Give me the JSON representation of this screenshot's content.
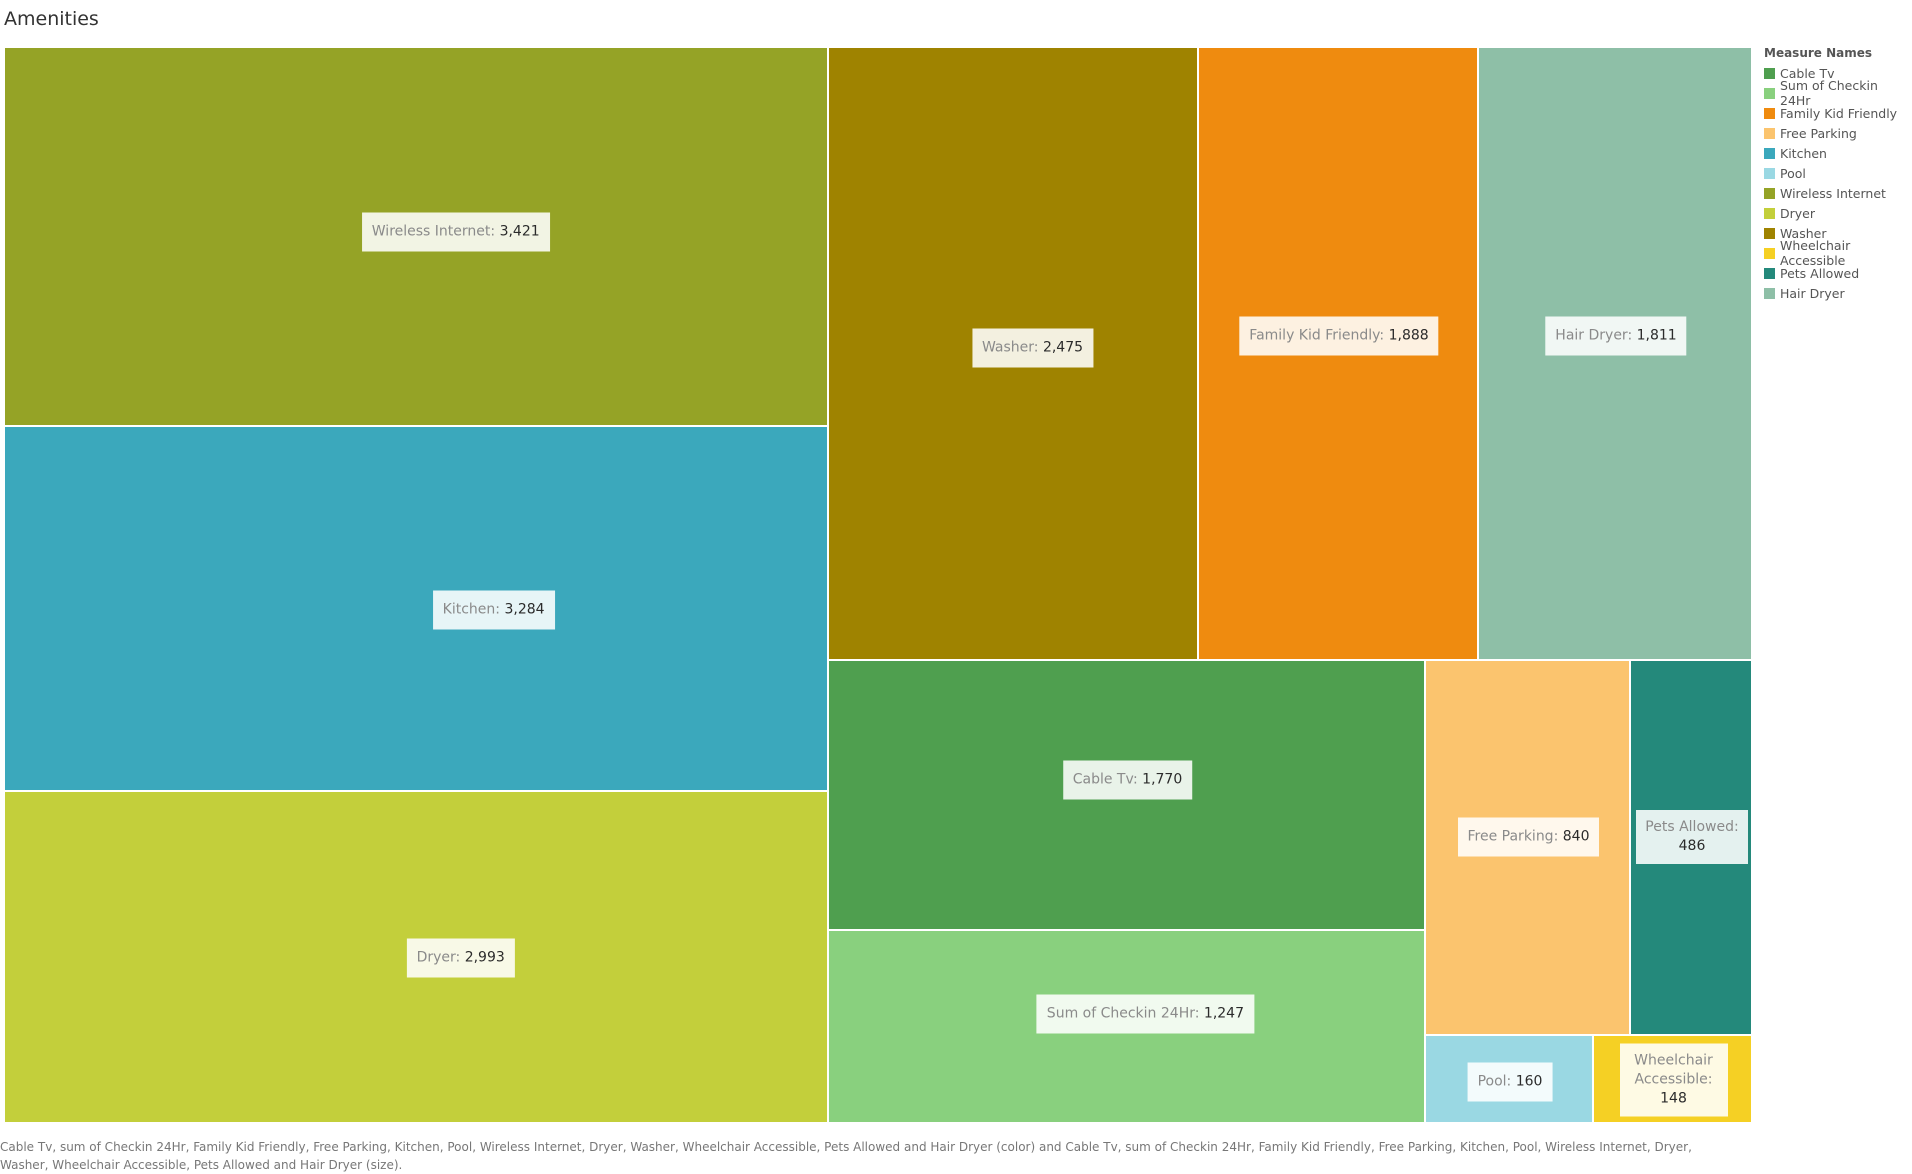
{
  "title": "Amenities",
  "caption": "Cable Tv, sum of Checkin 24Hr, Family Kid Friendly, Free Parking, Kitchen, Pool, Wireless Internet, Dryer, Washer, Wheelchair Accessible, Pets Allowed and Hair Dryer (color) and Cable Tv, sum of Checkin 24Hr, Family Kid Friendly, Free Parking, Kitchen, Pool, Wireless Internet, Dryer, Washer, Wheelchair Accessible, Pets Allowed and Hair Dryer (size).",
  "legend": {
    "title": "Measure Names",
    "items": [
      {
        "label": "Cable Tv",
        "color": "#4f9f4f"
      },
      {
        "label": "Sum of Checkin 24Hr",
        "color": "#89d07e"
      },
      {
        "label": "Family Kid Friendly",
        "color": "#ef8b0f"
      },
      {
        "label": "Free Parking",
        "color": "#fbc46e"
      },
      {
        "label": "Kitchen",
        "color": "#3ba8bc"
      },
      {
        "label": "Pool",
        "color": "#9ad8e3"
      },
      {
        "label": "Wireless Internet",
        "color": "#95a326"
      },
      {
        "label": "Dryer",
        "color": "#c3cf3b"
      },
      {
        "label": "Washer",
        "color": "#9f8300"
      },
      {
        "label": "Wheelchair Accessible",
        "color": "#f5d024"
      },
      {
        "label": "Pets Allowed",
        "color": "#24897b"
      },
      {
        "label": "Hair Dryer",
        "color": "#8ebfa7"
      }
    ]
  },
  "chart_data": {
    "type": "treemap",
    "title": "Amenities",
    "series": [
      {
        "name": "Wireless Internet",
        "value": 3421,
        "value_label": "3,421",
        "color": "#95a326"
      },
      {
        "name": "Kitchen",
        "value": 3284,
        "value_label": "3,284",
        "color": "#3ba8bc"
      },
      {
        "name": "Dryer",
        "value": 2993,
        "value_label": "2,993",
        "color": "#c3cf3b"
      },
      {
        "name": "Washer",
        "value": 2475,
        "value_label": "2,475",
        "color": "#9f8300"
      },
      {
        "name": "Family Kid Friendly",
        "value": 1888,
        "value_label": "1,888",
        "color": "#ef8b0f"
      },
      {
        "name": "Hair Dryer",
        "value": 1811,
        "value_label": "1,811",
        "color": "#8ebfa7"
      },
      {
        "name": "Cable Tv",
        "value": 1770,
        "value_label": "1,770",
        "color": "#4f9f4f"
      },
      {
        "name": "Sum of Checkin 24Hr",
        "value": 1247,
        "value_label": "1,247",
        "color": "#89d07e"
      },
      {
        "name": "Free Parking",
        "value": 840,
        "value_label": "840",
        "color": "#fbc46e"
      },
      {
        "name": "Pets Allowed",
        "value": 486,
        "value_label": "486",
        "color": "#24897b"
      },
      {
        "name": "Pool",
        "value": 160,
        "value_label": "160",
        "color": "#9ad8e3"
      },
      {
        "name": "Wheelchair Accessible",
        "value": 148,
        "value_label": "148",
        "color": "#f5d024"
      }
    ]
  }
}
